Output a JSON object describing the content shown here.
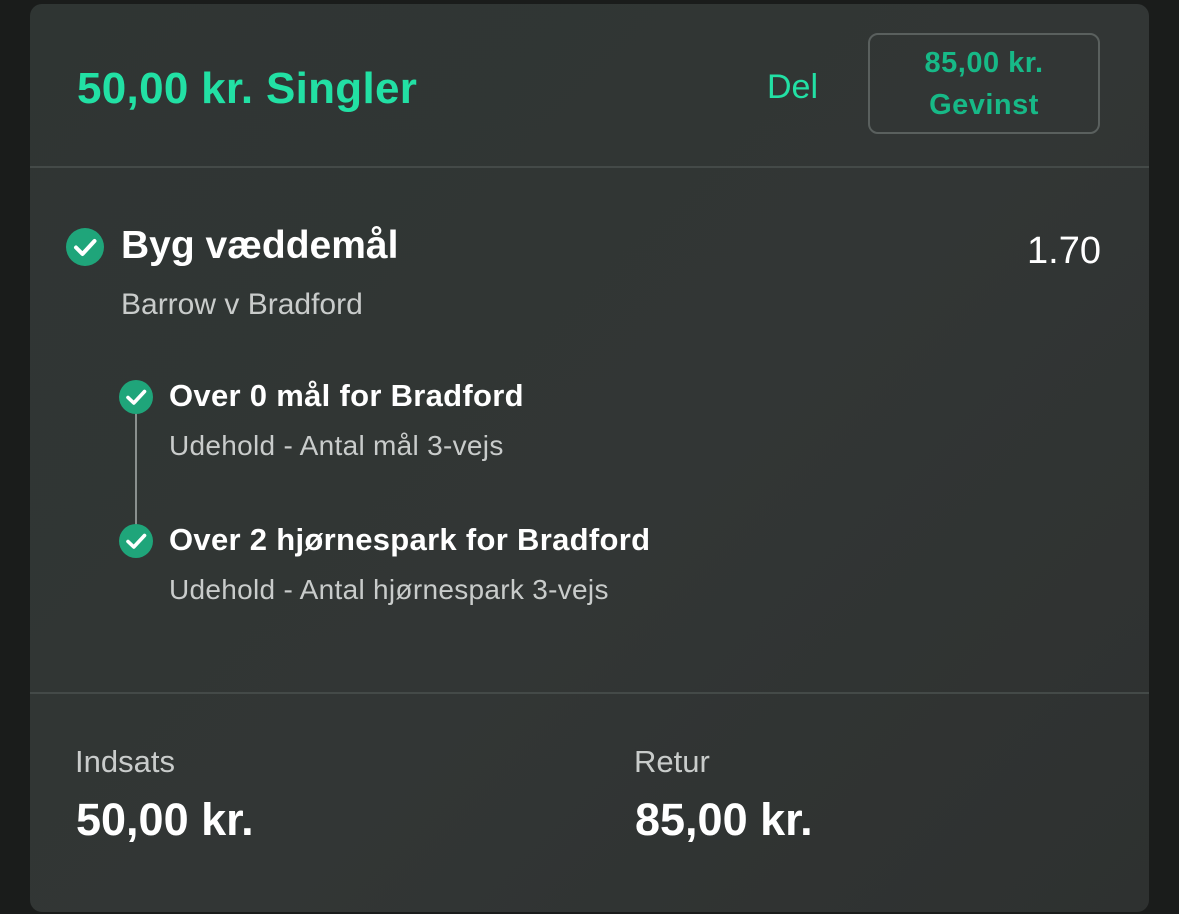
{
  "header": {
    "title": "50,00 kr. Singler",
    "share_label": "Del",
    "winnings_amount": "85,00 kr.",
    "winnings_label": "Gevinst"
  },
  "bet": {
    "title": "Byg væddemål",
    "odds": "1.70",
    "match": "Barrow v Bradford",
    "legs": [
      {
        "title": "Over 0 mål for Bradford",
        "subtitle": "Udehold - Antal mål 3-vejs"
      },
      {
        "title": "Over 2 hjørnespark for Bradford",
        "subtitle": "Udehold - Antal hjørnespark 3-vejs"
      }
    ]
  },
  "footer": {
    "stake_label": "Indsats",
    "stake_value": "50,00 kr.",
    "return_label": "Retur",
    "return_value": "85,00 kr."
  },
  "colors": {
    "accent": "#22e0a4",
    "check_green": "#1fa57a",
    "card_bg": "#313534"
  },
  "icons": {
    "status": "check-circle-icon"
  }
}
